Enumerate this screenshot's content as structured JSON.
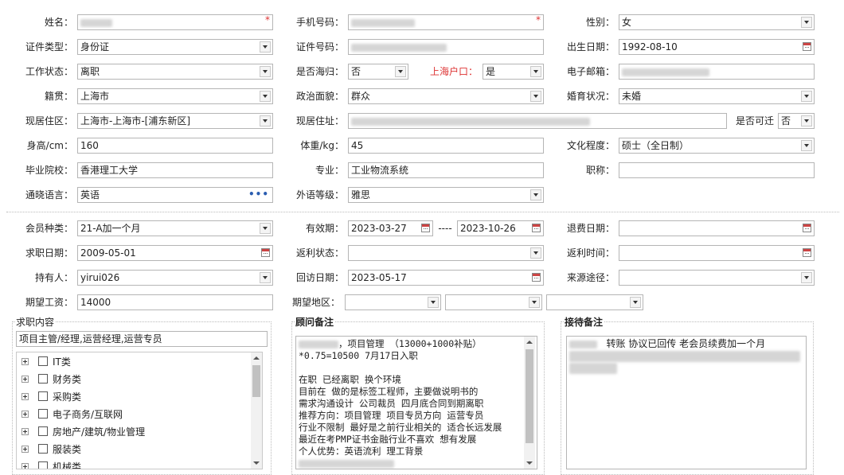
{
  "fields": {
    "name": {
      "label": "姓名：",
      "required": "*"
    },
    "phone": {
      "label": "手机号码：",
      "required": "*"
    },
    "gender": {
      "label": "性别：",
      "value": "女"
    },
    "id_type": {
      "label": "证件类型：",
      "value": "身份证"
    },
    "id_number": {
      "label": "证件号码："
    },
    "birthday": {
      "label": "出生日期：",
      "value": "1992-08-10"
    },
    "work_status": {
      "label": "工作状态：",
      "value": "离职"
    },
    "returnee": {
      "label": "是否海归：",
      "value": "否"
    },
    "shanghai_hukou": {
      "label": "上海户口：",
      "value": "是"
    },
    "email": {
      "label": "电子邮箱："
    },
    "native_place": {
      "label": "籍贯：",
      "value": "上海市"
    },
    "political": {
      "label": "政治面貌：",
      "value": "群众"
    },
    "marital": {
      "label": "婚育状况：",
      "value": "未婚"
    },
    "current_area": {
      "label": "现居住区：",
      "value": "上海市-上海市-[浦东新区]"
    },
    "current_address": {
      "label": "现居住址："
    },
    "relocate": {
      "label": "是否可迁",
      "value": "否"
    },
    "height": {
      "label": "身高/cm：",
      "value": "160"
    },
    "weight": {
      "label": "体重/kg：",
      "value": "45"
    },
    "education": {
      "label": "文化程度：",
      "value": "硕士（全日制）"
    },
    "school": {
      "label": "毕业院校：",
      "value": "香港理工大学"
    },
    "major": {
      "label": "专业：",
      "value": "工业物流系统"
    },
    "title": {
      "label": "职称：",
      "value": ""
    },
    "languages": {
      "label": "通晓语言：",
      "value": "英语"
    },
    "lang_level": {
      "label": "外语等级：",
      "value": "雅思"
    },
    "member_type": {
      "label": "会员种类：",
      "value": "21-A加一个月"
    },
    "valid_period": {
      "label": "有效期：",
      "start": "2023-03-27",
      "sep": "----",
      "end": "2023-10-26"
    },
    "refund_date": {
      "label": "退费日期：",
      "value": ""
    },
    "job_date": {
      "label": "求职日期：",
      "value": "2009-05-01"
    },
    "rebate_status": {
      "label": "返利状态：",
      "value": ""
    },
    "rebate_time": {
      "label": "返利时间：",
      "value": ""
    },
    "holder": {
      "label": "持有人：",
      "value": "yirui026"
    },
    "visit_date": {
      "label": "回访日期：",
      "value": "2023-05-17"
    },
    "source": {
      "label": "来源途径：",
      "value": ""
    },
    "expected_salary": {
      "label": "期望工资：",
      "value": "14000"
    },
    "expected_region": {
      "label": "期望地区："
    }
  },
  "job_content": {
    "title": "求职内容",
    "value": "项目主管/经理,运营经理,运营专员",
    "tree": [
      "IT类",
      "财务类",
      "采购类",
      "电子商务/互联网",
      "房地产/建筑/物业管理",
      "服装类",
      "机械类"
    ]
  },
  "advisor_notes": {
    "title": "顾问备注",
    "lines": [
      "，项目管理 （13000+1000补贴）",
      "*0.75=10500  7月17日入职",
      "",
      "在职 已经离职 换个环境",
      "目前在 做的是标签工程师，主要做说明书的",
      "需求沟通设计 公司裁员 四月底合同到期离职",
      "推荐方向：项目管理 项目专员方向 运营专员",
      "行业不限制 最好是之前行业相关的 适合长远发展",
      "最近在考PMP证书金融行业不喜欢 想有发展",
      "个人优势：英语流利 理工背景"
    ]
  },
  "reception_notes": {
    "title": "接待备注",
    "line1": "转账  协议已回传  老会员续费加一个月"
  }
}
